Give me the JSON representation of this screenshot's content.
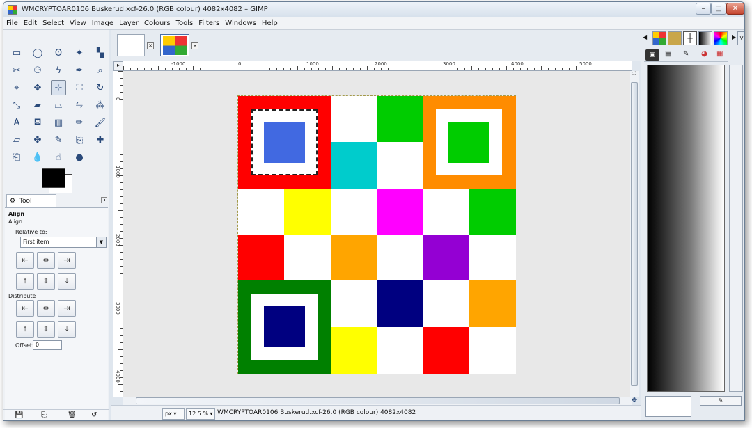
{
  "window": {
    "title": "WMCRYPTOAR0106 Buskerud.xcf-26.0 (RGB colour) 4082x4082 – GIMP",
    "controls": [
      "minimize",
      "maximize",
      "close"
    ]
  },
  "menu": [
    "File",
    "Edit",
    "Select",
    "View",
    "Image",
    "Layer",
    "Colours",
    "Tools",
    "Filters",
    "Windows",
    "Help"
  ],
  "toolbox": {
    "tools": [
      "rect-select",
      "ellipse-select",
      "free-select",
      "fuzzy-select",
      "by-color-select",
      "scissors",
      "foreground-select",
      "paths",
      "color-picker",
      "zoom",
      "measure",
      "move",
      "align",
      "crop",
      "rotate",
      "scale",
      "shear",
      "perspective",
      "flip",
      "cage",
      "text",
      "bucket-fill",
      "blend",
      "pencil",
      "paintbrush",
      "eraser",
      "airbrush",
      "ink",
      "clone",
      "heal",
      "perspective-clone",
      "blur",
      "smudge",
      "dodge-burn"
    ],
    "active_tool": "align"
  },
  "tool_options": {
    "tab_label": "Tool Options",
    "title": "Align",
    "subtitle": "Align",
    "relative_label": "Relative to:",
    "relative_value": "First item",
    "distribute_label": "Distribute",
    "offset_label": "Offset:",
    "offset_value": "0"
  },
  "ruler": {
    "h_labels": [
      "-1000",
      "0",
      "1000",
      "2000",
      "3000",
      "4000",
      "5000"
    ],
    "v_labels": [
      "0",
      "1000",
      "2000",
      "3000",
      "4000"
    ]
  },
  "board": {
    "grid": [
      [
        "#ff0000",
        "#ff0000",
        "#ffffff",
        "#00cc00",
        "#ff8c00",
        "#ff8c00"
      ],
      [
        "#ff0000",
        "#ff0000",
        "#00cccc",
        "#ffffff",
        "#ff8c00",
        "#ff8c00"
      ],
      [
        "#ffffff",
        "#ffff00",
        "#ffffff",
        "#ff00ff",
        "#ffffff",
        "#00cc00"
      ],
      [
        "#ff0000",
        "#ffffff",
        "#ffa500",
        "#ffffff",
        "#9400d3",
        "#ffffff"
      ],
      [
        "#008000",
        "#008000",
        "#ffffff",
        "#000080",
        "#ffffff",
        "#ffa500"
      ],
      [
        "#008000",
        "#008000",
        "#ffff00",
        "#ffffff",
        "#ff0000",
        "#ffffff"
      ]
    ],
    "finders": [
      {
        "corner": "top-left",
        "outer": "#ff0000",
        "inner": "#4169e1"
      },
      {
        "corner": "top-right",
        "outer": "#ff8c00",
        "inner": "#00cc00"
      },
      {
        "corner": "bottom-left",
        "outer": "#008000",
        "inner": "#000080"
      }
    ]
  },
  "status": {
    "unit": "px",
    "zoom": "12.5 %",
    "text": "WMCRYPTOAR0106 Buskerud.xcf-26.0 (RGB colour) 4082x4082"
  }
}
